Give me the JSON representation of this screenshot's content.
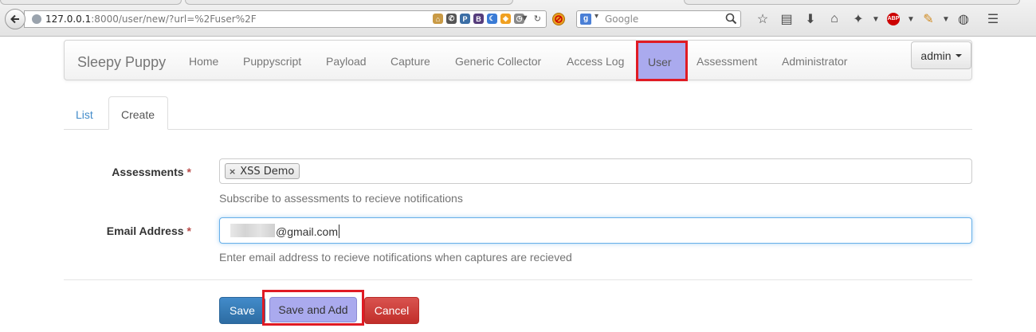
{
  "browser": {
    "url_host": "127.0.0.1",
    "url_rest": ":8000/user/new/?url=%2Fuser%2F",
    "search_placeholder": "Google",
    "extension_icons": [
      "home-icon",
      "phone-icon",
      "python-icon",
      "bootstrap-icon",
      "moon-icon",
      "shield-icon",
      "clock-icon"
    ],
    "toolbar_icons": [
      "star-icon",
      "reading-list-icon",
      "download-icon",
      "home-icon",
      "bug-icon",
      "adblock-icon",
      "paint-icon",
      "globe-icon",
      "menu-icon"
    ],
    "adblock_label": "ABP",
    "bootstrap_label": "B"
  },
  "navbar": {
    "brand": "Sleepy Puppy",
    "items": [
      {
        "label": "Home"
      },
      {
        "label": "Puppyscript"
      },
      {
        "label": "Payload"
      },
      {
        "label": "Capture"
      },
      {
        "label": "Generic Collector"
      },
      {
        "label": "Access Log"
      },
      {
        "label": "User",
        "active": true
      },
      {
        "label": "Assessment"
      },
      {
        "label": "Administrator"
      }
    ],
    "user_menu": "admin"
  },
  "tabs": {
    "list": "List",
    "create": "Create"
  },
  "form": {
    "assessments": {
      "label": "Assessments",
      "required_mark": "*",
      "selected": [
        "XSS Demo"
      ],
      "remove_glyph": "×",
      "help": "Subscribe to assessments to recieve notifications"
    },
    "email": {
      "label": "Email Address",
      "required_mark": "*",
      "value_visible": "@gmail.com",
      "help": "Enter email address to recieve notifications when captures are recieved"
    }
  },
  "buttons": {
    "save": "Save",
    "save_and_add": "Save and Add",
    "cancel": "Cancel"
  },
  "colors": {
    "highlight_fill": "#aaaaee",
    "highlight_border": "#e01b24",
    "primary": "#428bca",
    "danger": "#d9534f",
    "link": "#428bca"
  }
}
